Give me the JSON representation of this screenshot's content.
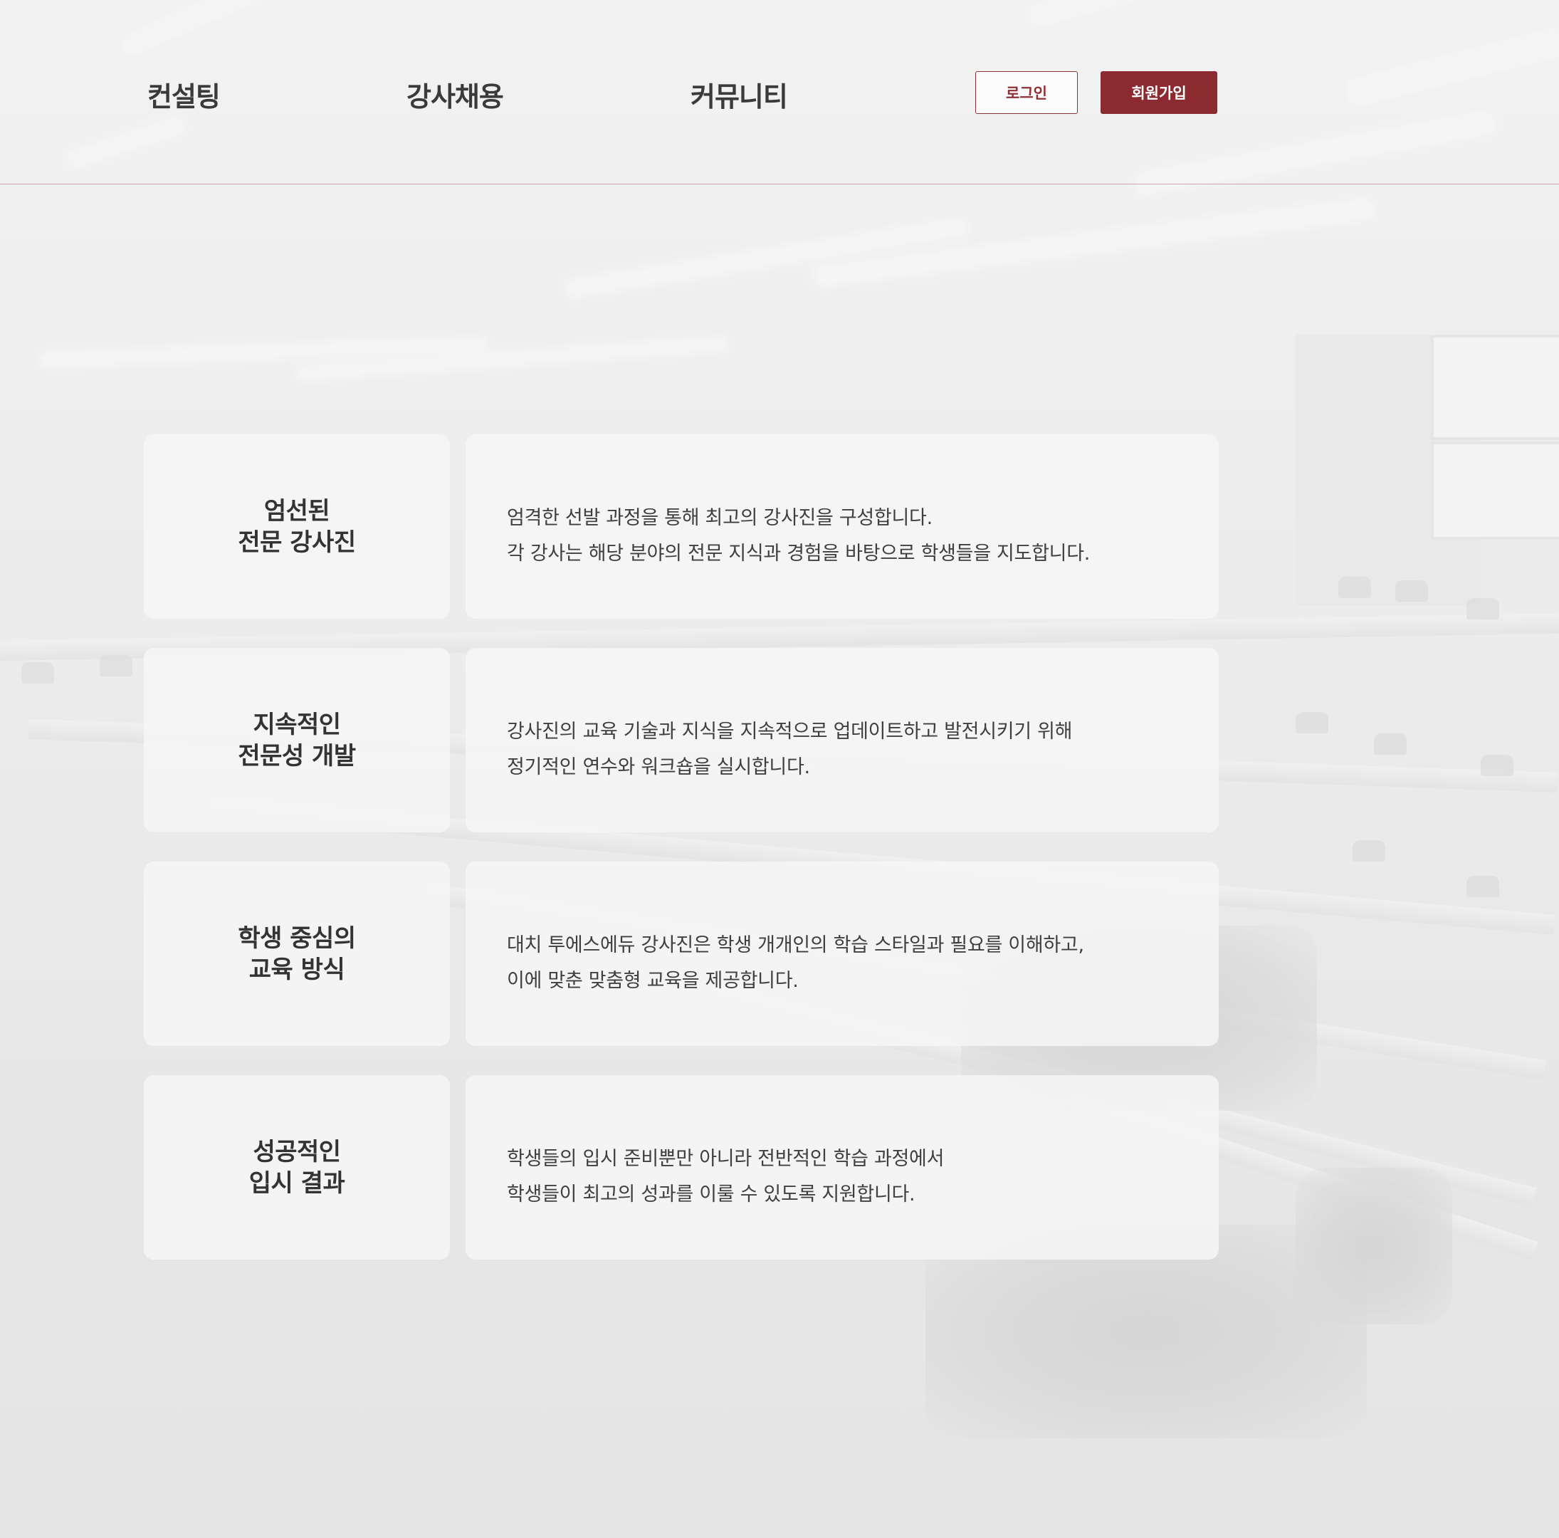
{
  "header": {
    "nav": [
      {
        "label": "컨설팅"
      },
      {
        "label": "강사채용"
      },
      {
        "label": "커뮤니티"
      }
    ],
    "login_label": "로그인",
    "signup_label": "회원가입"
  },
  "features": [
    {
      "title_lines": [
        "엄선된",
        "전문 강사진"
      ],
      "desc_lines": [
        "엄격한 선발 과정을 통해 최고의 강사진을 구성합니다.",
        "각 강사는 해당 분야의 전문 지식과 경험을 바탕으로 학생들을 지도합니다."
      ]
    },
    {
      "title_lines": [
        "지속적인",
        "전문성 개발"
      ],
      "desc_lines": [
        "강사진의 교육 기술과 지식을 지속적으로 업데이트하고 발전시키기 위해",
        "정기적인 연수와 워크숍을 실시합니다."
      ]
    },
    {
      "title_lines": [
        "학생 중심의",
        "교육 방식"
      ],
      "desc_lines": [
        "대치 투에스에듀 강사진은 학생 개개인의 학습 스타일과 필요를 이해하고,",
        "이에 맞춘 맞춤형 교육을 제공합니다."
      ]
    },
    {
      "title_lines": [
        "성공적인",
        "입시 결과"
      ],
      "desc_lines": [
        "학생들의 입시 준비뿐만 아니라 전반적인 학습 과정에서",
        "학생들이 최고의 성과를 이룰 수 있도록 지원합니다."
      ]
    }
  ],
  "colors": {
    "accent": "#8b2b30",
    "header_divider": "#caa8aa",
    "text_dark": "#333333"
  }
}
